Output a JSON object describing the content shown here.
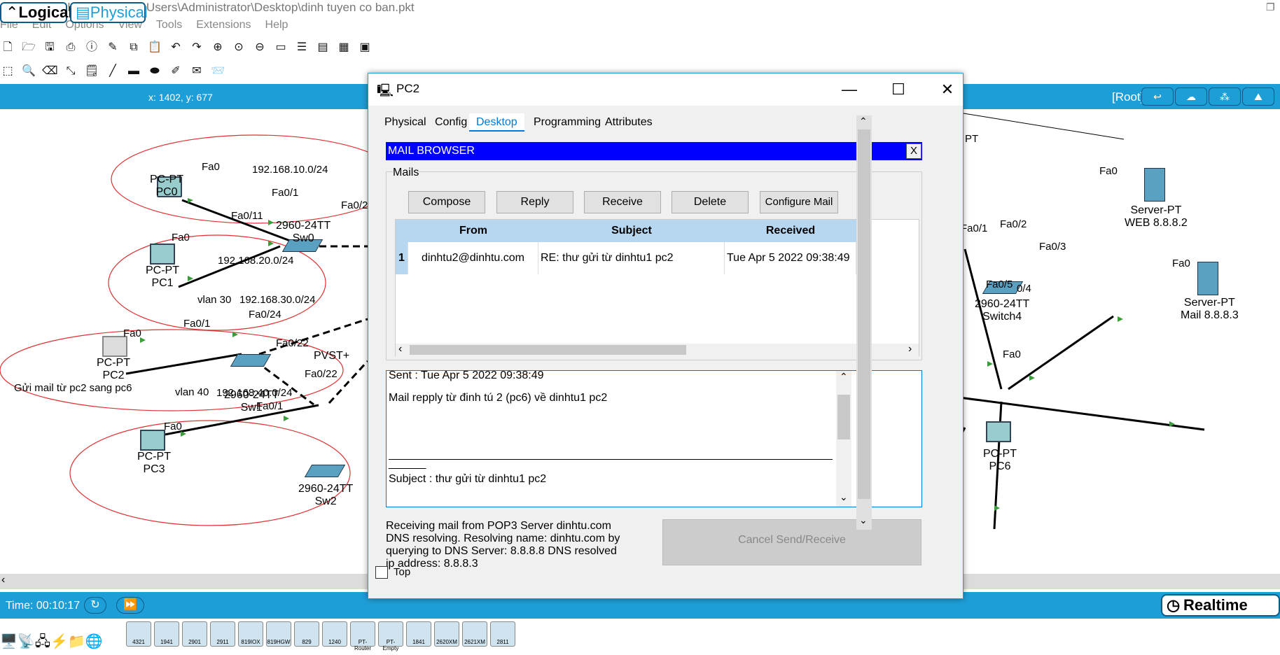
{
  "app": {
    "title": "Cisco Packet Tracer - C:\\Users\\Administrator\\Desktop\\dinh tuyen co ban.pkt"
  },
  "menu": [
    "File",
    "Edit",
    "Options",
    "View",
    "Tools",
    "Extensions",
    "Help"
  ],
  "modes": {
    "logical": "Logical",
    "physical": "Physical",
    "coords": "x: 1402, y: 677",
    "root": "[Root]"
  },
  "canvas": {
    "devices": [
      {
        "name": "PC-PT",
        "id": "PC0"
      },
      {
        "name": "PC-PT",
        "id": "PC1"
      },
      {
        "name": "PC-PT",
        "id": "PC2"
      },
      {
        "name": "PC-PT",
        "id": "PC3"
      },
      {
        "name": "2960-24TT",
        "id": "Sw0"
      },
      {
        "name": "2960-24TT",
        "id": "Sw1"
      },
      {
        "name": "2960-24TT",
        "id": "Sw2"
      },
      {
        "name": "2960-24TT",
        "id": "Switch4"
      },
      {
        "name": "Server-PT",
        "id": "WEB 8.8.8.2"
      },
      {
        "name": "Server-PT",
        "id": "Mail 8.8.8.3"
      },
      {
        "name": "PC-PT",
        "id": "PC6"
      }
    ],
    "labels": {
      "net10": "192.168.10.0/24",
      "net20": "192.168.20.0/24",
      "net30": "192.168.30.0/24",
      "net40": "192.168.40.0/24",
      "vlan30": "vlan 30",
      "vlan40": "vlan 40",
      "pvst": "PVST+",
      "note": "Gửi mail từ pc2 sang pc6",
      "fa0": "Fa0",
      "fa01": "Fa0/1",
      "fa011": "Fa0/11",
      "fa02": "Fa0/2",
      "fa024": "Fa0/24",
      "fa022": "Fa0/22",
      "fa022b": "Fa0/22",
      "fa03": "Fa0/3",
      "fa05": "Fa0/5",
      "p04": "0/4",
      "pt": "PT"
    }
  },
  "dialog": {
    "title": "PC2",
    "tabs": [
      "Physical",
      "Config",
      "Desktop",
      "Programming",
      "Attributes"
    ],
    "active_tab": "Desktop",
    "mail_browser": {
      "header": "MAIL BROWSER",
      "close": "X",
      "group": "Mails",
      "buttons": [
        "Compose",
        "Reply",
        "Receive",
        "Delete",
        "Configure Mail"
      ],
      "columns": [
        "From",
        "Subject",
        "Received"
      ],
      "rows": [
        {
          "num": "1",
          "from": "dinhtu2@dinhtu.com",
          "subject": "RE: thư gửi từ dinhtu1 pc2",
          "received": "Tue Apr 5 2022 09:38:49"
        }
      ],
      "message": {
        "sent": "Sent : Tue Apr 5 2022 09:38:49",
        "body": "Mail repply từ đinh tú 2 (pc6) về dinhtu1 pc2",
        "sep": "______",
        "subject": "Subject : thư gửi từ dinhtu1 pc2"
      },
      "status": "Receiving mail from POP3 Server dinhtu.com DNS resolving. Resolving name: dinhtu.com by querying to DNS Server: 8.8.8.8  DNS resolved ip address: 8.8.8.3",
      "cancel": "Cancel Send/Receive"
    },
    "top_label": "Top"
  },
  "status": {
    "time": "Time: 00:10:17",
    "realtime": "Realtime"
  },
  "tray": [
    "4321",
    "1941",
    "2901",
    "2911",
    "819IOX",
    "819HGW",
    "829",
    "1240",
    "PT-Router",
    "PT-Empty",
    "1841",
    "2620XM",
    "2621XM",
    "2811"
  ]
}
